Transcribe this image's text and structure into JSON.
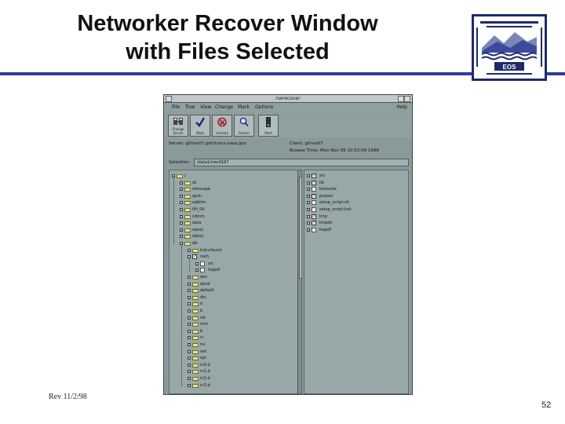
{
  "slide": {
    "title_line1": "Networker Recover Window",
    "title_line2": "with Files Selected",
    "rev": "Rev 11/2/98",
    "page_number": "52",
    "logo_text": "EOS",
    "accent_color": "#2f3d9a"
  },
  "window": {
    "title": "nwrecover",
    "menu": [
      "File",
      "Tree",
      "View",
      "Change",
      "Mark",
      "Options"
    ],
    "help": "Help",
    "toolbar": [
      {
        "label": "Change Server",
        "icon": "change-server-icon"
      },
      {
        "label": "Mark",
        "icon": "checkmark-icon"
      },
      {
        "label": "Unmark",
        "icon": "unmark-icon"
      },
      {
        "label": "Search",
        "icon": "search-icon"
      },
      {
        "label": "Start",
        "icon": "traffic-light-icon"
      }
    ],
    "client_label": "Client:",
    "client_value": "g0nss07",
    "server_label": "Server:",
    "server_value": "g0nss07.gsfcb.ecs.nasa.gov",
    "browse_label": "Browse Time:",
    "browse_value": "Mon Nov 09 10:53:04 1998",
    "selection_label": "Selection:",
    "selection_value": "/data1/nwc0187",
    "tree": [
      {
        "name": "/",
        "depth": 0,
        "type": "folder"
      },
      {
        "name": "dc",
        "depth": 1,
        "type": "folder"
      },
      {
        "name": "netscape",
        "depth": 1,
        "type": "folder"
      },
      {
        "name": "opsh",
        "depth": 1,
        "type": "folder"
      },
      {
        "name": "sqlbtm",
        "depth": 1,
        "type": "folder"
      },
      {
        "name": "IIH_04",
        "depth": 1,
        "type": "folder"
      },
      {
        "name": "cdrom",
        "depth": 1,
        "type": "folder"
      },
      {
        "name": "data",
        "depth": 1,
        "type": "folder"
      },
      {
        "name": "data1",
        "depth": 1,
        "type": "folder"
      },
      {
        "name": "data2",
        "depth": 1,
        "type": "folder"
      },
      {
        "name": "dd",
        "depth": 1,
        "type": "folder"
      },
      {
        "name": "lost+found",
        "depth": 2,
        "type": "folder"
      },
      {
        "name": "rash",
        "depth": 2,
        "type": "checked"
      },
      {
        "name": "src",
        "depth": 3,
        "type": "file"
      },
      {
        "name": "ttapdf",
        "depth": 3,
        "type": "file"
      },
      {
        "name": "dev",
        "depth": 2,
        "type": "folder"
      },
      {
        "name": "devd",
        "depth": 2,
        "type": "folder"
      },
      {
        "name": "default",
        "depth": 2,
        "type": "folder"
      },
      {
        "name": "dts",
        "depth": 2,
        "type": "folder"
      },
      {
        "name": "d",
        "depth": 2,
        "type": "folder"
      },
      {
        "name": "b",
        "depth": 2,
        "type": "folder"
      },
      {
        "name": "ret",
        "depth": 2,
        "type": "folder"
      },
      {
        "name": "mnt",
        "depth": 2,
        "type": "folder"
      },
      {
        "name": "b",
        "depth": 2,
        "type": "folder"
      },
      {
        "name": "rc",
        "depth": 2,
        "type": "folder"
      },
      {
        "name": "rsi",
        "depth": 2,
        "type": "folder"
      },
      {
        "name": "net",
        "depth": 2,
        "type": "folder"
      },
      {
        "name": "opt",
        "depth": 2,
        "type": "folder"
      },
      {
        "name": "rc0.d",
        "depth": 2,
        "type": "folder"
      },
      {
        "name": "rc1.d",
        "depth": 2,
        "type": "folder"
      },
      {
        "name": "rc2.d",
        "depth": 2,
        "type": "folder"
      },
      {
        "name": "rc3.d",
        "depth": 2,
        "type": "folder"
      }
    ],
    "files": [
      {
        "name": "src",
        "type": "checked"
      },
      {
        "name": "lib",
        "type": "checked"
      },
      {
        "name": "testsuite",
        "type": "file"
      },
      {
        "name": "project",
        "type": "checked"
      },
      {
        "name": "setup_script.sh",
        "type": "file"
      },
      {
        "name": "setup_script.ksh",
        "type": "file"
      },
      {
        "name": "tmp",
        "type": "checked"
      },
      {
        "name": "tmpdir",
        "type": "checked"
      },
      {
        "name": "ttapdf",
        "type": "file"
      }
    ]
  }
}
